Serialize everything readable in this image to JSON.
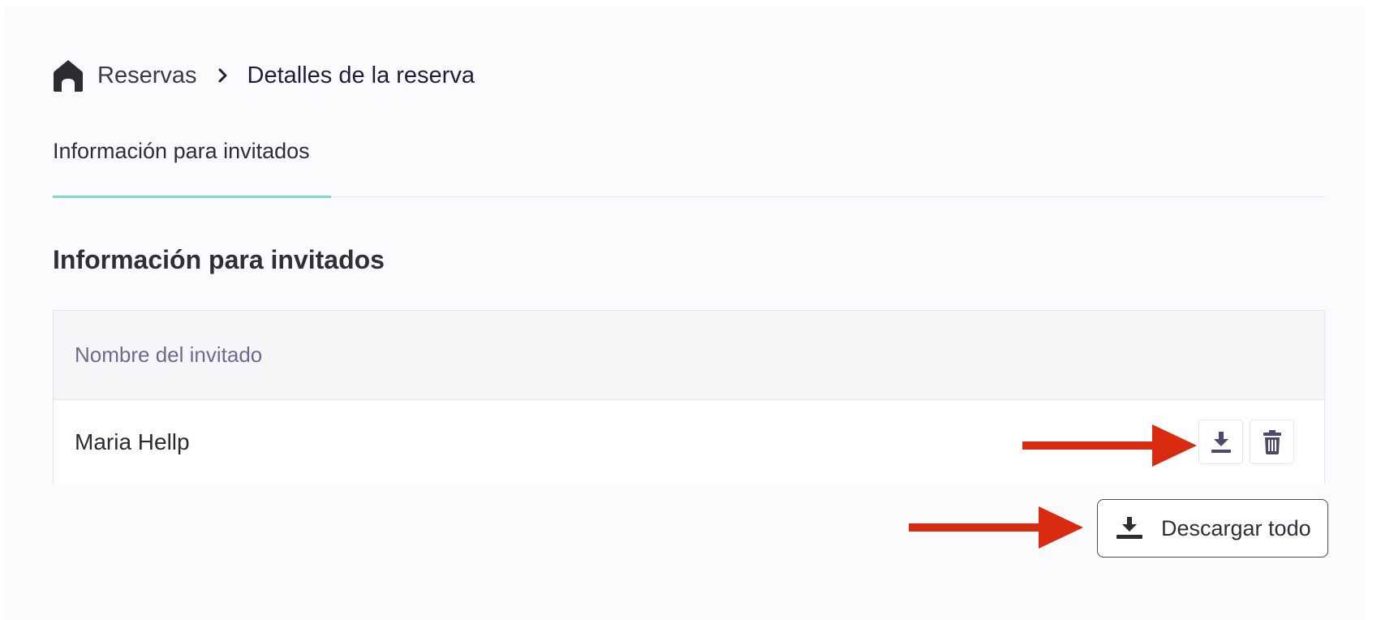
{
  "breadcrumb": {
    "home_icon": "home-icon",
    "root": "Reservas",
    "separator_icon": "chevron-right-icon",
    "current": "Detalles de la reserva"
  },
  "tabs": [
    {
      "label": "Información para invitados",
      "active": true
    }
  ],
  "section": {
    "title": "Información para invitados"
  },
  "guests_table": {
    "columns": [
      "Nombre del invitado"
    ],
    "rows": [
      {
        "name": "Maria Hellp",
        "actions": [
          "download-icon",
          "trash-icon"
        ]
      }
    ]
  },
  "download_all": {
    "label": "Descargar todo",
    "icon": "download-icon"
  },
  "colors": {
    "accent_tab": "#7fdcc6",
    "header_text": "#6a6a92",
    "icon": "#4a4a6e",
    "annotation_arrow": "#d92b0f"
  }
}
